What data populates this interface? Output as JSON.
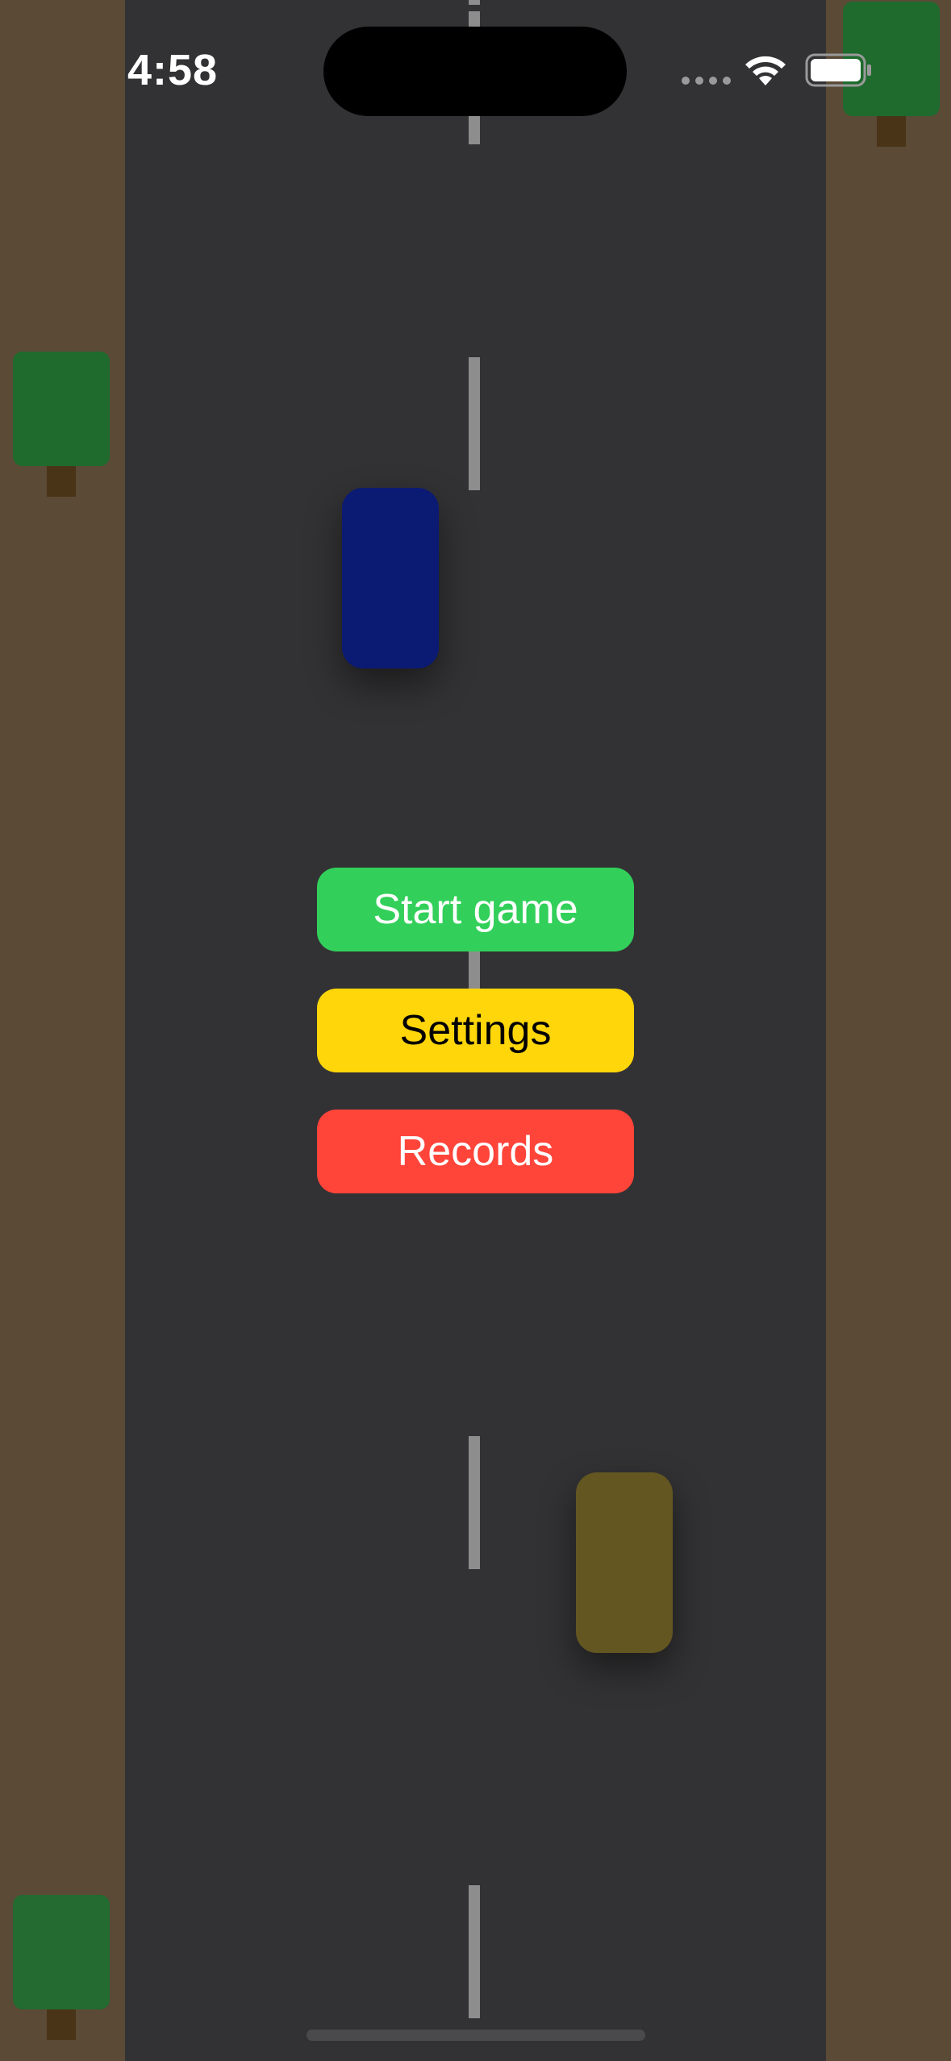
{
  "status_bar": {
    "time": "4:58",
    "wifi_icon": "wifi-icon",
    "battery_icon": "battery-icon",
    "signal_icon": "cellular-signal-icon"
  },
  "menu": {
    "start_label": "Start game",
    "settings_label": "Settings",
    "records_label": "Records"
  },
  "colors": {
    "road": "#323234",
    "roadside": "#5a4a36",
    "lane_marking": "#8d8d8d",
    "tree_crown": "#1e6b2d",
    "tree_trunk": "#4a3418",
    "car_blue": "#0b1a73",
    "car_olive": "#635621",
    "start_button": "#32d05a",
    "settings_button": "#ffd60a",
    "records_button": "#ff443a"
  }
}
